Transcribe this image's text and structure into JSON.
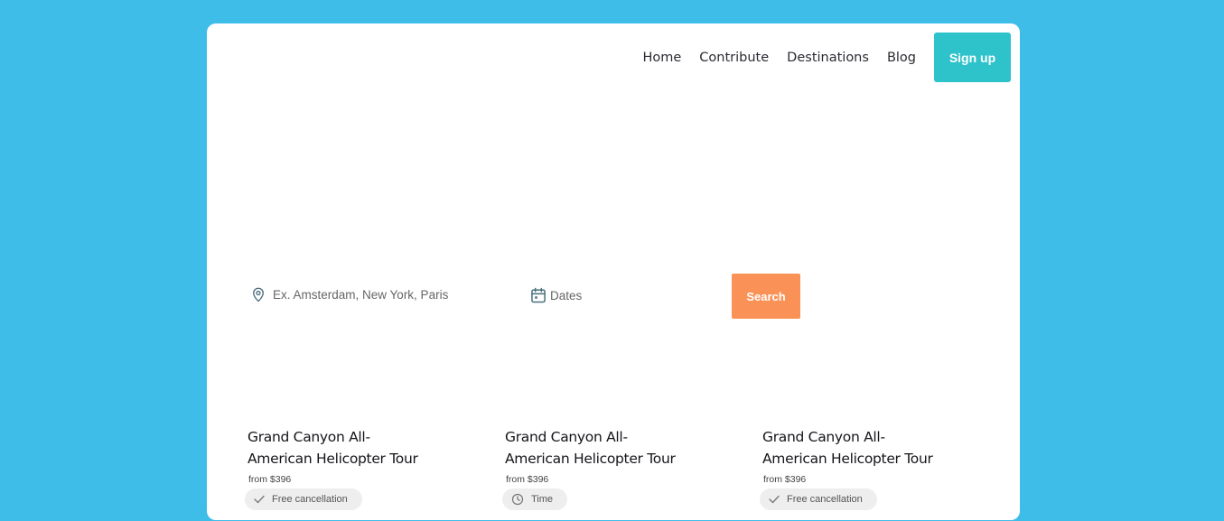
{
  "nav": {
    "links": [
      "Home",
      "Contribute",
      "Destinations",
      "Blog"
    ],
    "signup_label": "Sign up"
  },
  "search": {
    "location_placeholder": "Ex. Amsterdam, New York, Paris",
    "dates_placeholder": "Dates",
    "button_label": "Search"
  },
  "tours": [
    {
      "title": "Grand Canyon All-American Helicopter Tour",
      "price": "from $396",
      "badge": "Free cancellation",
      "badge_icon": "check-icon"
    },
    {
      "title": "Grand Canyon All-American Helicopter Tour",
      "price": "from $396",
      "badge": "Time",
      "badge_icon": "clock-icon"
    },
    {
      "title": "Grand Canyon All-American Helicopter Tour",
      "price": "from $396",
      "badge": "Free cancellation",
      "badge_icon": "check-icon"
    }
  ],
  "colors": {
    "page_background": "#3fbde9",
    "signup_button": "#2ec2cb",
    "search_button": "#fa9257"
  }
}
